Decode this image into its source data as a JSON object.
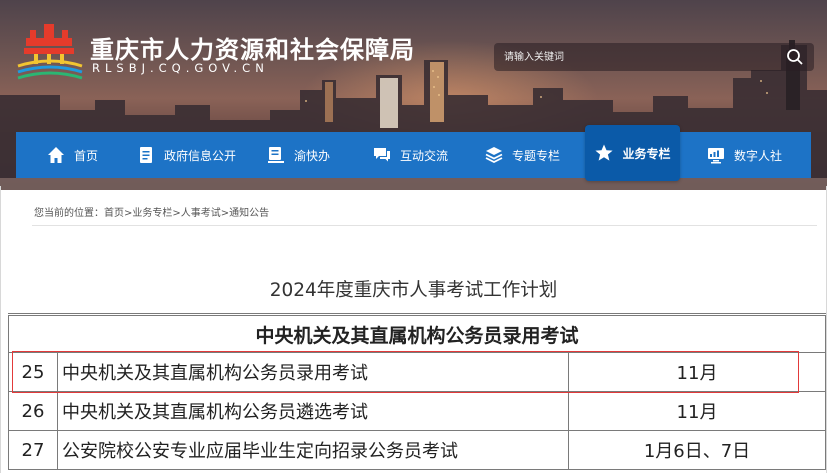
{
  "header": {
    "site_title": "重庆市人力资源和社会保障局",
    "site_domain": "RLSBJ.CQ.GOV.CN",
    "search_placeholder": "请输入关键词"
  },
  "nav": {
    "items": [
      {
        "label": "首页",
        "icon": "home-icon"
      },
      {
        "label": "政府信息公开",
        "icon": "document-icon"
      },
      {
        "label": "渝快办",
        "icon": "id-card-icon"
      },
      {
        "label": "互动交流",
        "icon": "chat-icon"
      },
      {
        "label": "专题专栏",
        "icon": "layers-icon"
      },
      {
        "label": "业务专栏",
        "icon": "star-icon",
        "active": true
      },
      {
        "label": "数字人社",
        "icon": "monitor-icon"
      }
    ]
  },
  "breadcrumb": {
    "prefix": "您当前的位置：",
    "items": [
      "首页",
      "业务专栏",
      "人事考试",
      "通知公告"
    ],
    "separator": ">"
  },
  "document": {
    "title": "2024年度重庆市人事考试工作计划"
  },
  "table": {
    "section_header": "中央机关及其直属机构公务员录用考试",
    "rows": [
      {
        "no": "25",
        "name": "中央机关及其直属机构公务员录用考试",
        "month": "11月"
      },
      {
        "no": "26",
        "name": "中央机关及其直属机构公务员遴选考试",
        "month": "11月"
      },
      {
        "no": "27",
        "name": "公安院校公安专业应届毕业生定向招录公务员考试",
        "month": "1月6日、7日"
      }
    ]
  },
  "colors": {
    "nav_bg": "#1d73c6",
    "nav_active": "#0b5aa8",
    "highlight": "#e23a3a"
  }
}
